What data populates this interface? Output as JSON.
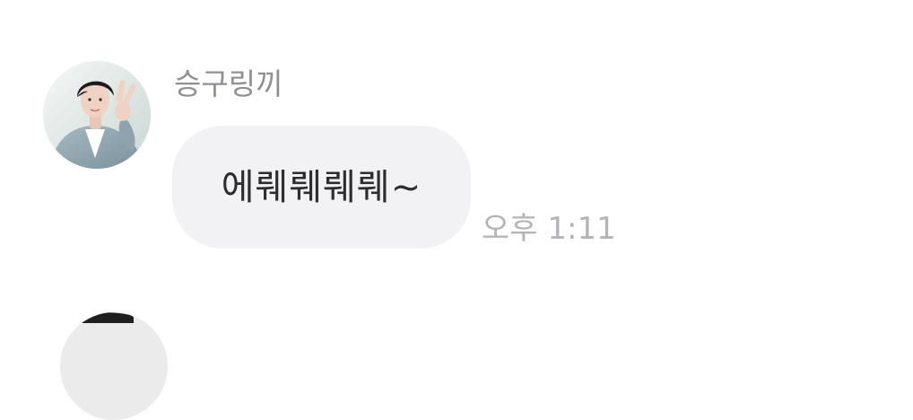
{
  "message": {
    "sender_name": "승구링끼",
    "text": "에뤠뤠뤠뤠~",
    "timestamp": "오후 1:11"
  },
  "colors": {
    "background": "#ffffff",
    "bubble": "#f2f2f4",
    "sender_name": "#8f8f94",
    "message_text": "#2d2d31",
    "timestamp": "#b3b3b8"
  }
}
